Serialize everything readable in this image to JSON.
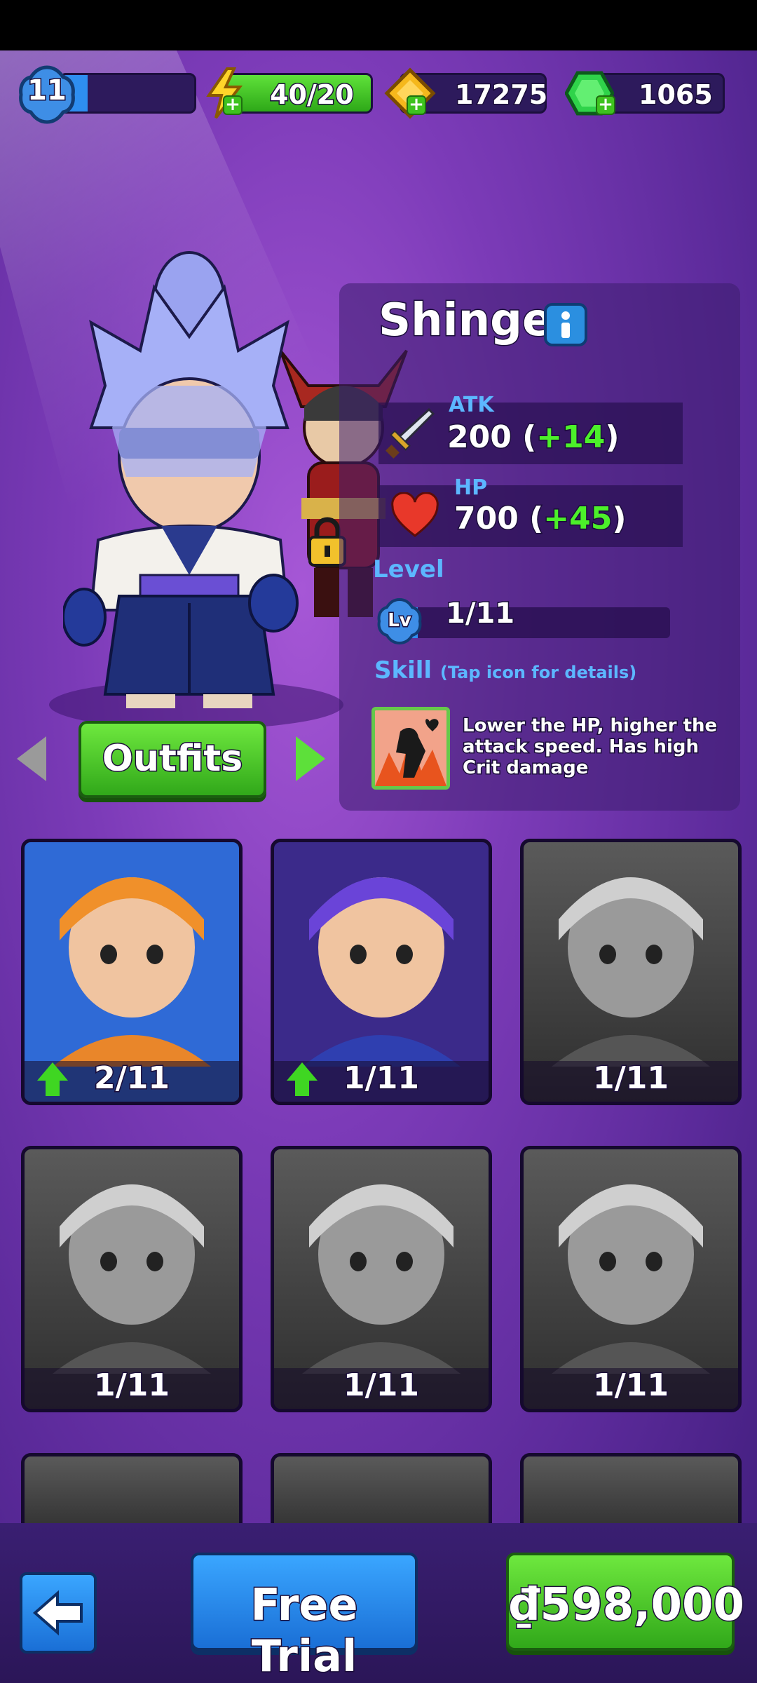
{
  "header": {
    "player_level": "11",
    "xp_progress": 0.2,
    "energy": "40/20",
    "gold": "17275",
    "gems": "1065"
  },
  "hero": {
    "name": "Shingen",
    "atk_label": "ATK",
    "atk_value": "200 (",
    "atk_bonus": "+14",
    "atk_close": ")",
    "hp_label": "HP",
    "hp_value": "700 (",
    "hp_bonus": "+45",
    "hp_close": ")",
    "level_label": "Level",
    "level_badge": "Lv",
    "level_value": "1/11",
    "level_progress": 0.09,
    "skill_label": "Skill",
    "skill_hint": "(Tap icon for details)",
    "skill_description": "Lower the HP, higher the attack speed. Has high Crit damage"
  },
  "outfits_label": "Outfits",
  "roster": [
    {
      "count": "2/11",
      "upgradable": true,
      "unlocked": true,
      "bg": "#2f6ad6"
    },
    {
      "count": "1/11",
      "upgradable": true,
      "unlocked": true,
      "bg": "#3b2a8a"
    },
    {
      "count": "1/11",
      "upgradable": false,
      "unlocked": false,
      "bg": "#4a4a4a"
    },
    {
      "count": "1/11",
      "upgradable": false,
      "unlocked": false,
      "bg": "#4a4a4a"
    },
    {
      "count": "1/11",
      "upgradable": false,
      "unlocked": false,
      "bg": "#4a4a4a"
    },
    {
      "count": "1/11",
      "upgradable": false,
      "unlocked": false,
      "bg": "#4a4a4a"
    }
  ],
  "footer": {
    "free_trial_label": "Free Trial",
    "price_label": "₫598,000"
  },
  "colors": {
    "accent_green": "#3ec21f",
    "accent_blue": "#2b8fe0",
    "bonus_green": "#4cf02a",
    "label_blue": "#5cb7ff"
  }
}
